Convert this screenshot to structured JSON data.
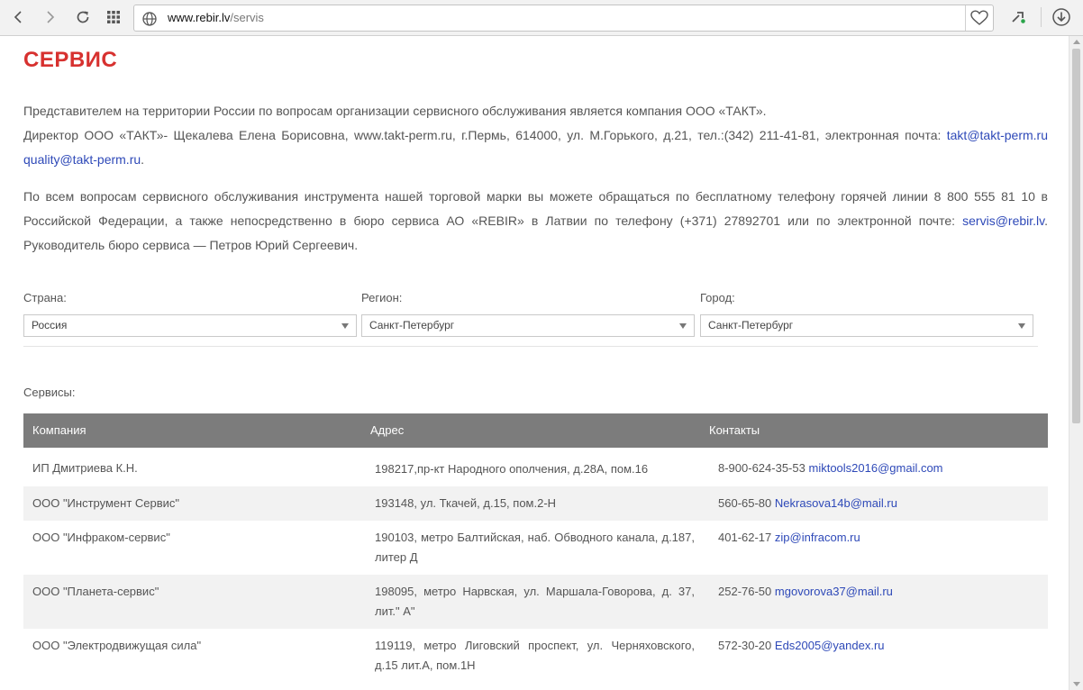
{
  "browser": {
    "url_host": "www.rebir.lv",
    "url_path": "/servis"
  },
  "page": {
    "title": "СЕРВИС",
    "para1": {
      "line1": "Представителем на территории России по вопросам организации сервисного обслуживания является компания ООО «ТАКТ».",
      "line2": "Директор ООО «ТАКТ»- Щекалева Елена Борисовна, www.takt-perm.ru, г.Пермь, 614000, ул. М.Горького, д.21, тел.:(342) 211-41-81, электронная почта:",
      "email1": "takt@takt-perm.ru",
      "email2": "quality@takt-perm.ru",
      "end": "."
    },
    "para2": {
      "text": "По всем вопросам сервисного обслуживания инструмента нашей торговой марки вы можете обращаться по бесплатному телефону горячей линии 8 800 555 81 10 в Российской Федерации, а также непосредственно в бюро сервиса АО «REBIR» в Латвии по телефону (+371) 27892701 или по электронной почте:",
      "email": "servis@rebir.lv",
      "tail": ". Руководитель бюро сервиса — Петров Юрий Сергеевич."
    }
  },
  "filters": {
    "country": {
      "label": "Страна:",
      "value": "Россия"
    },
    "region": {
      "label": "Регион:",
      "value": "Санкт-Петербург"
    },
    "city": {
      "label": "Город:",
      "value": "Санкт-Петербург"
    }
  },
  "services": {
    "label": "Сервисы:",
    "columns": [
      "Компания",
      "Адрес",
      "Контакты"
    ],
    "rows": [
      {
        "company": "ИП Дмитриева К.Н.",
        "address": "198217,пр-кт Народного ополчения, д.28А, пом.16",
        "phone": "8-900-624-35-53",
        "email": "miktools2016@gmail.com"
      },
      {
        "company": "ООО \"Инструмент Сервис\"",
        "address": "193148, ул. Ткачей, д.15, пом.2-Н",
        "phone": "560-65-80",
        "email": "Nekrasova14b@mail.ru"
      },
      {
        "company": "ООО \"Инфраком-сервис\"",
        "address": "190103, метро Балтийская, наб. Обводного канала, д.187, литер Д",
        "phone": "401-62-17",
        "email": "zip@infracom.ru"
      },
      {
        "company": "ООО \"Планета-сервис\"",
        "address": "198095, метро Нарвская, ул. Маршала-Говорова, д. 37, лит.\" А\"",
        "phone": "252-76-50",
        "email": "mgovorova37@mail.ru"
      },
      {
        "company": "ООО \"Электродвижущая сила\"",
        "address": "119119, метро Лиговский проспект, ул. Черняховского, д.15 лит.А, пом.1Н",
        "phone": "572-30-20",
        "email": "Eds2005@yandex.ru"
      }
    ]
  }
}
